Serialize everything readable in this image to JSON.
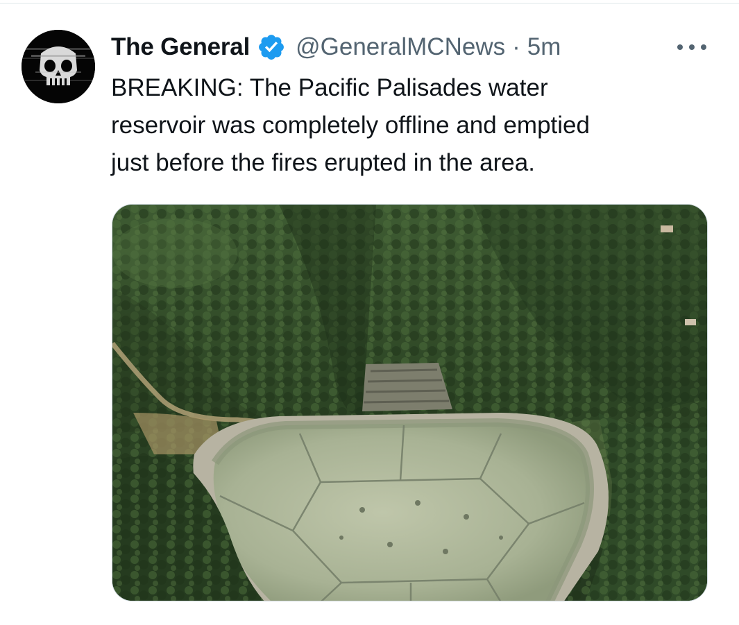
{
  "tweet": {
    "author": {
      "display_name": "The General",
      "handle": "@GeneralMCNews",
      "verified": true,
      "avatar_icon": "skull-avatar"
    },
    "separator": "·",
    "timestamp": "5m",
    "more_icon": "more-horizontal-icon",
    "text_lines": [
      "BREAKING: The Pacific Palisades water",
      "reservoir was completely offline and emptied",
      "just before the fires erupted in the area."
    ],
    "media": {
      "type": "photo"
    }
  },
  "colors": {
    "primary_text": "#0f1419",
    "secondary_text": "#536471",
    "verified_blue": "#1d9bf0",
    "divider": "#eff3f4"
  }
}
